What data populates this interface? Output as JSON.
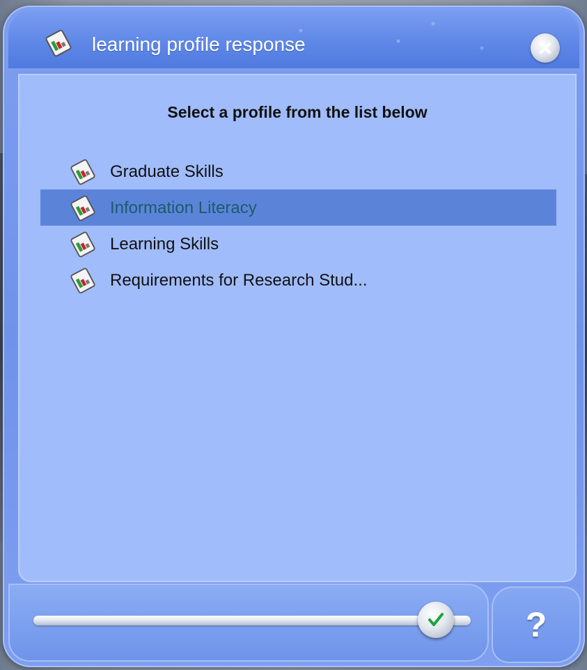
{
  "window": {
    "title": "learning profile response",
    "title_icon": "profile-document-icon",
    "close_icon": "close-icon"
  },
  "main": {
    "heading": "Select a profile from the list below",
    "profiles": [
      {
        "label": "Graduate Skills",
        "icon": "profile-document-icon",
        "selected": false
      },
      {
        "label": "Information Literacy",
        "icon": "profile-document-icon",
        "selected": true
      },
      {
        "label": "Learning Skills",
        "icon": "profile-document-icon",
        "selected": false
      },
      {
        "label": "Requirements for Research Stud...",
        "icon": "profile-document-icon",
        "selected": false
      }
    ]
  },
  "footer": {
    "confirm_icon": "checkmark-icon",
    "slider_value_fraction": 0.92,
    "help_label": "?"
  },
  "colors": {
    "window_blue": "#6f93ea",
    "panel_blue": "#a0bcfb",
    "selected_row": "#5b84d9",
    "selected_text": "#1d5a6c",
    "check_green": "#1aa53a"
  }
}
